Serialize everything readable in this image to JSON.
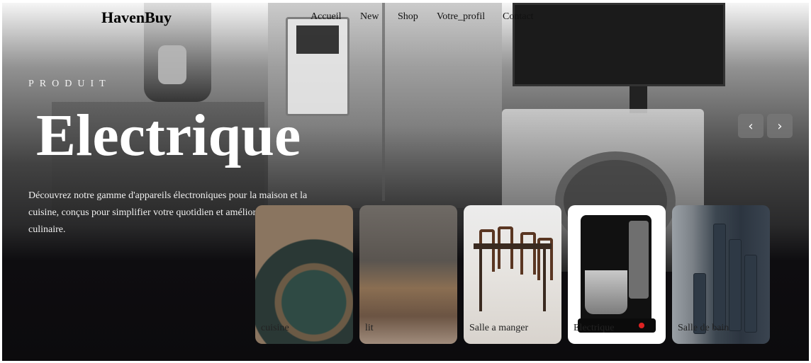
{
  "brand": {
    "name": "HavenBuy"
  },
  "nav": {
    "items": [
      {
        "label": "Accueil"
      },
      {
        "label": "New"
      },
      {
        "label": "Shop"
      },
      {
        "label": "Votre_profil"
      },
      {
        "label": "Contact"
      }
    ]
  },
  "hero": {
    "eyebrow": "PRODUIT",
    "title": "Electrique",
    "description": "Découvrez notre gamme d'appareils électroniques pour la maison et la cuisine, conçus pour simplifier votre quotidien et améliorer votre expérience culinaire."
  },
  "carousel": {
    "prev_icon": "chevron-left-icon",
    "next_icon": "chevron-right-icon",
    "prev_glyph": "‹",
    "next_glyph": "›"
  },
  "categories": [
    {
      "label": "cuisine",
      "active": false
    },
    {
      "label": "lit",
      "active": false
    },
    {
      "label": "Salle a manger",
      "active": false
    },
    {
      "label": "Electrique",
      "active": true
    },
    {
      "label": "Salle de bain",
      "active": false
    }
  ],
  "colors": {
    "background_dark": "#0c0b0d",
    "active_card": "#ffffff",
    "arrow_button": "#787878"
  }
}
